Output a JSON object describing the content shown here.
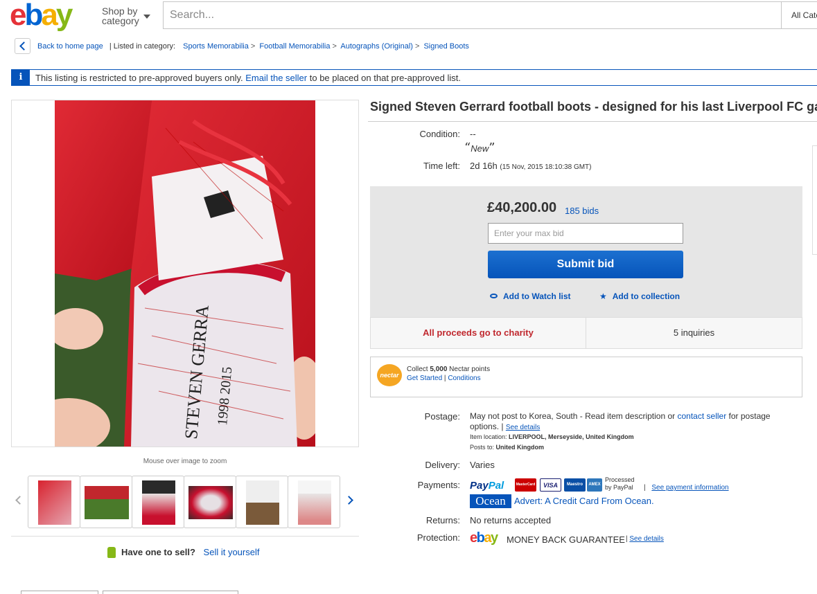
{
  "header": {
    "logo_letters": [
      "e",
      "b",
      "a",
      "y"
    ],
    "shop_by_line1": "Shop by",
    "shop_by_line2": "category",
    "search_placeholder": "Search...",
    "all_categories": "All Categories"
  },
  "breadcrumb": {
    "back_label": "Back to home page",
    "listed_in": "| Listed in category:",
    "items": [
      "Sports Memorabilia",
      "Football Memorabilia",
      "Autographs (Original)",
      "Signed Boots"
    ],
    "separator": ">"
  },
  "banner": {
    "icon": "i",
    "text_before": "This listing is restricted to pre-approved buyers only.",
    "link": "Email the seller",
    "text_after": "to be placed on that pre-approved list."
  },
  "gallery": {
    "zoom_hint": "Mouse over image to zoom",
    "thumbnail_count": 6
  },
  "sell": {
    "prompt": "Have one to sell?",
    "link": "Sell it yourself"
  },
  "listing": {
    "title": "Signed Steven Gerrard football boots - designed for his last Liverpool FC game",
    "condition_label": "Condition:",
    "condition_value": "--",
    "condition_quote_open": "“",
    "condition_desc": "New",
    "condition_quote_close": "”",
    "time_left_label": "Time left:",
    "time_left_value": "2d 16h",
    "end_time": "(15 Nov, 2015   18:10:38 GMT)"
  },
  "bid": {
    "price": "£40,200.00",
    "bids": "185 bids",
    "input_placeholder": "Enter your max bid",
    "submit_label": "Submit bid",
    "watch_label": "Add to Watch list",
    "collection_label": "Add to collection",
    "charity_label": "All proceeds go to charity",
    "inquiries": "5 inquiries"
  },
  "nectar": {
    "logo": "nectar",
    "collect_prefix": "Collect",
    "points": "5,000",
    "collect_suffix": "Nectar points",
    "get_started": "Get Started",
    "divider": "|",
    "conditions": "Conditions"
  },
  "shipping": {
    "postage_label": "Postage:",
    "postage_text": "May not post to Korea, South - Read item description or",
    "contact_seller": "contact seller",
    "postage_text2": "for postage options.",
    "pipe": "|",
    "see_details": "See details",
    "location_label": "Item location:",
    "location_value": "LIVERPOOL, Merseyside, United Kingdom",
    "posts_to_label": "Posts to:",
    "posts_to_value": "United Kingdom",
    "delivery_label": "Delivery:",
    "delivery_value": "Varies",
    "payments_label": "Payments:",
    "paypal_a": "Pay",
    "paypal_b": "Pal",
    "card_mastercard": "MasterCard",
    "card_visa": "VISA",
    "card_maestro": "Maestro",
    "card_amex": "AMEX",
    "processed_line1": "Processed",
    "processed_line2": "by PayPal",
    "see_payment": "See payment information",
    "ocean_logo": "Ocean",
    "advert": "Advert: A Credit Card From Ocean.",
    "returns_label": "Returns:",
    "returns_value": "No returns accepted",
    "protection_label": "Protection:",
    "mbg": "MONEY BACK GUARANTEE",
    "mbg_see": "See details"
  },
  "colors": {
    "link": "#0654ba",
    "charity": "#c0282e",
    "boot_red": "#d8232f"
  }
}
